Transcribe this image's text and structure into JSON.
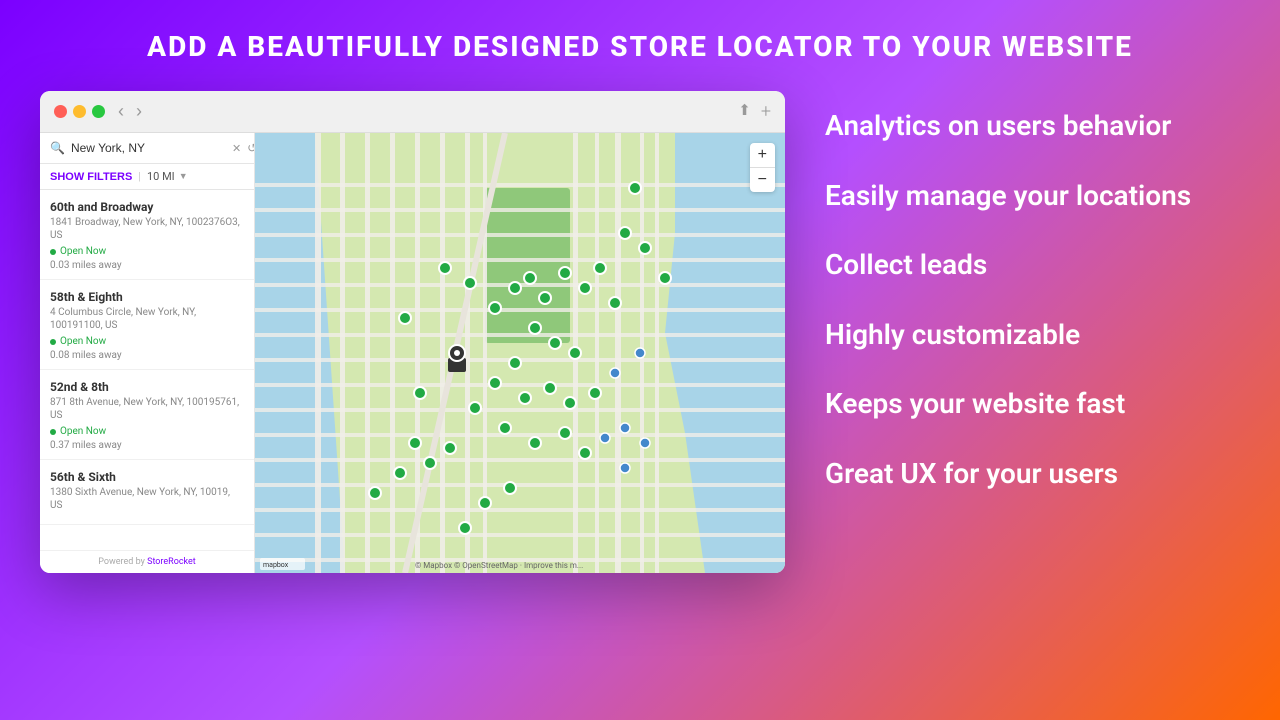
{
  "page": {
    "title": "ADD A BEAUTIFULLY DESIGNED STORE LOCATOR TO YOUR WEBSITE",
    "background_gradient": "linear-gradient(135deg, #7B00FF 0%, #B44FFF 50%, #FF6600 100%)"
  },
  "browser": {
    "dots": [
      "red",
      "yellow",
      "green"
    ],
    "nav": {
      "back": "‹",
      "forward": "›"
    },
    "actions": {
      "share": "⬆",
      "add": "+"
    }
  },
  "store_locator": {
    "search_placeholder": "New York, NY",
    "search_value": "New York, NY",
    "filter_label": "SHOW FILTERS",
    "distance_label": "10 MI",
    "stores": [
      {
        "name": "60th and Broadway",
        "address": "1841 Broadway, New York, NY, 1002376O3, US",
        "status": "Open Now",
        "distance": "0.03 miles away"
      },
      {
        "name": "58th & Eighth",
        "address": "4 Columbus Circle, New York, NY, 100191100, US",
        "status": "Open Now",
        "distance": "0.08 miles away"
      },
      {
        "name": "52nd & 8th",
        "address": "871 8th Avenue, New York, NY, 100195761, US",
        "status": "Open Now",
        "distance": "0.37 miles away"
      },
      {
        "name": "56th & Sixth",
        "address": "1380 Sixth Avenue, New York, NY, 10019, US",
        "status": null,
        "distance": null
      }
    ],
    "powered_by": "Powered by StoreRocket"
  },
  "features": [
    {
      "id": "analytics",
      "text": "Analytics on users behavior"
    },
    {
      "id": "manage",
      "text": "Easily manage your locations"
    },
    {
      "id": "leads",
      "text": "Collect leads"
    },
    {
      "id": "customizable",
      "text": "Highly customizable"
    },
    {
      "id": "fast",
      "text": "Keeps your website fast"
    },
    {
      "id": "ux",
      "text": "Great UX for your users"
    }
  ],
  "map": {
    "attribution": "© Mapbox © OpenStreetMap · Improve this m..."
  }
}
